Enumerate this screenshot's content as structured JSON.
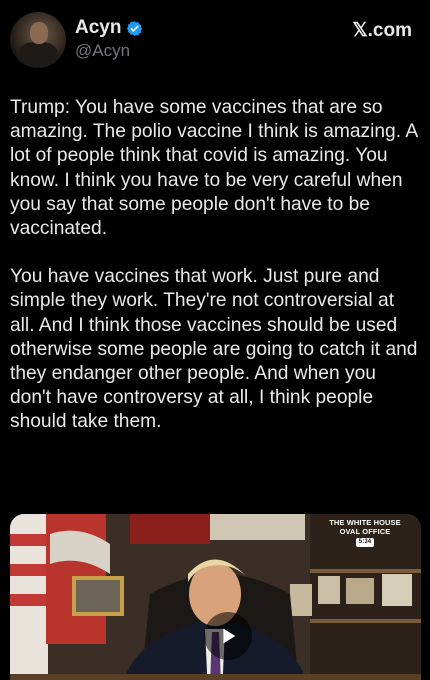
{
  "author": {
    "display_name": "Acyn",
    "handle": "@Acyn",
    "verified": true,
    "verified_color": "#1d9bf0"
  },
  "brand": {
    "label": "𝕏.com"
  },
  "tweet": {
    "paragraphs": [
      "Trump: You have some vaccines that are so amazing. The polio vaccine I think is amazing. A lot of people think that covid is amazing. You know. I think you have to be very careful when you say that some people don't have to be vaccinated.",
      "You have vaccines that work. Just pure and simple they work. They're not controversial at all. And I think those vaccines should be used otherwise some people are going to catch it and they endanger other people. And when you don't have controversy at all, I think people should take them."
    ]
  },
  "media": {
    "type": "video",
    "badge_line1": "THE WHITE HOUSE",
    "badge_line2": "OVAL OFFICE",
    "badge_time": "5:34",
    "play_icon": "play-icon"
  },
  "colors": {
    "background": "#000000",
    "text": "#e7e9ea",
    "secondary": "#71767b"
  }
}
